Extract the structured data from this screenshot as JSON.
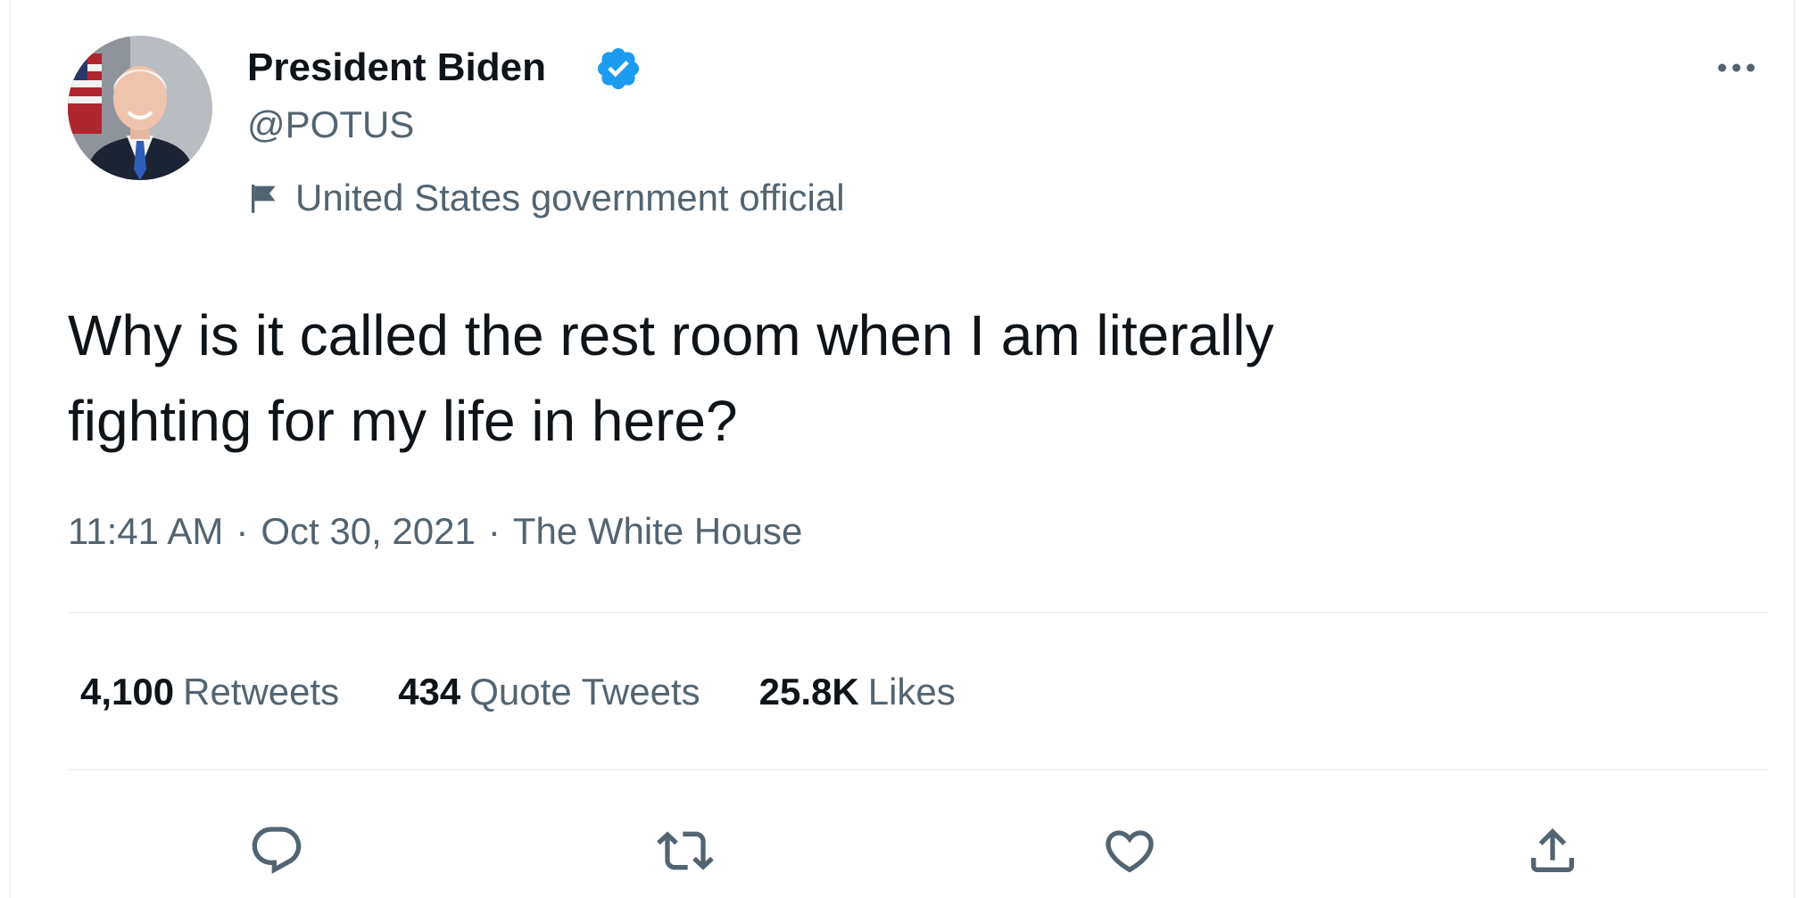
{
  "author": {
    "display_name": "President Biden",
    "handle": "@POTUS",
    "label": "United States government official",
    "verified": true
  },
  "tweet": {
    "text_lines": [
      "Why is it called the rest room when I am literally",
      "fighting for my life in here?"
    ],
    "time": "11:41 AM",
    "date": "Oct 30, 2021",
    "source": "The White House",
    "separator": "·"
  },
  "stats": {
    "retweets": {
      "count": "4,100",
      "label": "Retweets"
    },
    "quote_tweets": {
      "count": "434",
      "label": "Quote Tweets"
    },
    "likes": {
      "count": "25.8K",
      "label": "Likes"
    }
  },
  "icons": {
    "avatar": "avatar-photo",
    "verified": "verified-badge-icon",
    "more": "more-options-icon",
    "flag": "flag-icon",
    "reply": "reply-icon",
    "retweet": "retweet-icon",
    "like": "heart-icon",
    "share": "share-icon"
  },
  "colors": {
    "text_primary": "#0f1419",
    "text_secondary": "#536471",
    "verified": "#1d9bf0",
    "divider": "#eff3f4"
  }
}
